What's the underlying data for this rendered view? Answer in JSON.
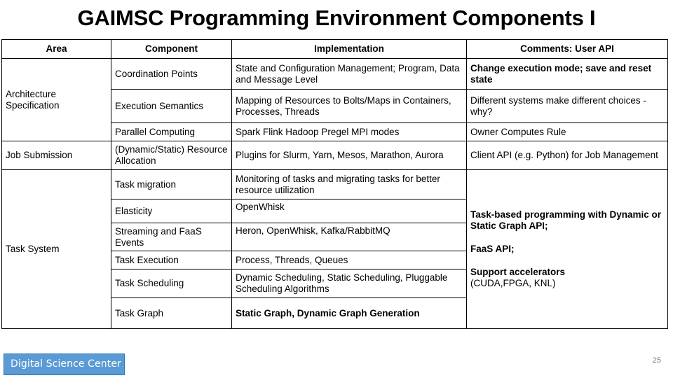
{
  "slide": {
    "title": "GAIMSC Programming Environment Components I",
    "page_number": "25",
    "footer_label": "Digital Science Center",
    "footer_bg": "#5b9bd5",
    "footer_border": "#2e75b6",
    "footer_text_color": "#ffffff"
  },
  "table": {
    "headers": {
      "area": "Area",
      "component": "Component",
      "implementation": "Implementation",
      "comments": "Comments: User API"
    },
    "areas": {
      "architecture": "Architecture Specification",
      "job_submission": "Job Submission",
      "task_system": "Task System"
    },
    "rows": [
      {
        "component": "Coordination Points",
        "implementation": "State and Configuration Management; Program, Data and Message Level",
        "comments": "Change execution mode; save and reset state"
      },
      {
        "component": "Execution Semantics",
        "implementation": "Mapping of Resources to Bolts/Maps in Containers, Processes, Threads",
        "comments": "Different systems make different choices - why?"
      },
      {
        "component": "Parallel Computing",
        "implementation": "Spark Flink Hadoop Pregel MPI modes",
        "comments": "Owner Computes Rule"
      },
      {
        "component": "(Dynamic/Static) Resource Allocation",
        "implementation": "Plugins for Slurm, Yarn, Mesos, Marathon, Aurora",
        "comments": "Client API (e.g. Python) for Job Management"
      },
      {
        "component": "Task migration",
        "implementation": "Monitoring of tasks and migrating tasks for better resource utilization"
      },
      {
        "component": "Elasticity",
        "implementation": "OpenWhisk"
      },
      {
        "component": "Streaming and FaaS Events",
        "implementation": "Heron, OpenWhisk, Kafka/RabbitMQ"
      },
      {
        "component": "Task Execution",
        "implementation": "Process, Threads, Queues"
      },
      {
        "component": "Task Scheduling",
        "implementation": "Dynamic Scheduling, Static Scheduling, Pluggable Scheduling Algorithms"
      },
      {
        "component": "Task Graph",
        "implementation": "Static Graph, Dynamic Graph Generation"
      }
    ],
    "task_system_comments": {
      "line1": "Task-based programming with Dynamic or Static Graph API;",
      "line2": "FaaS API;",
      "line3_bold": "Support accelerators",
      "line3_regular": "(CUDA,FPGA, KNL)"
    }
  }
}
